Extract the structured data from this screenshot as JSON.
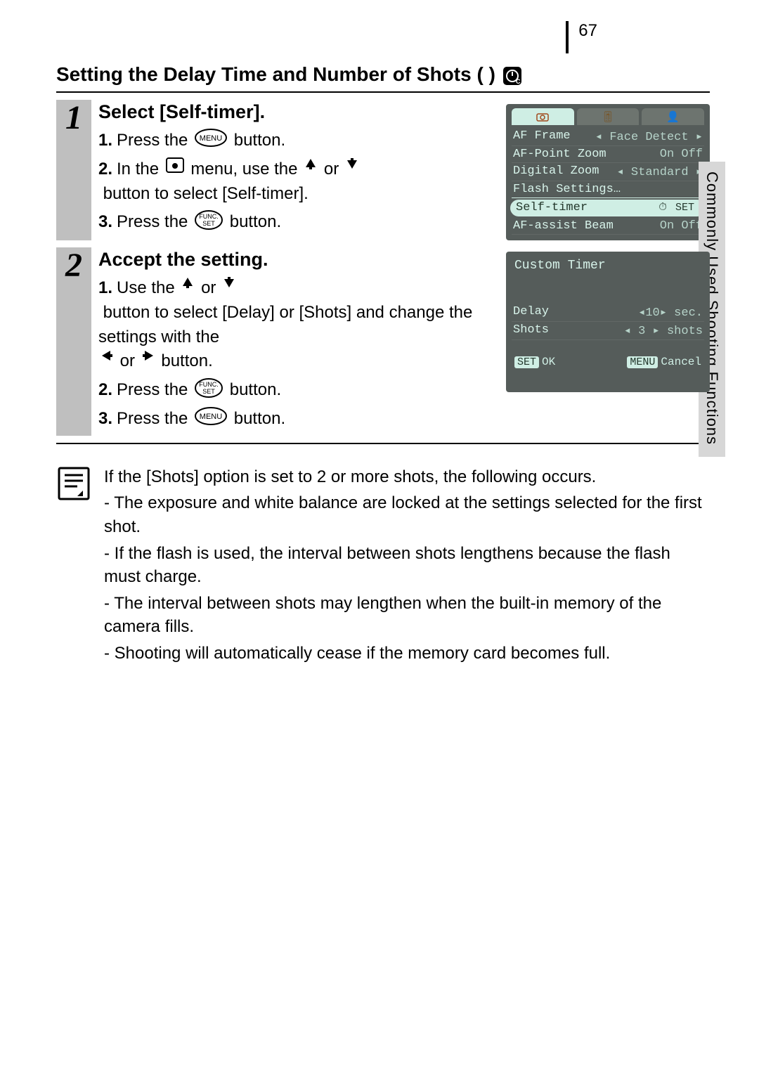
{
  "page_number": "67",
  "sidebar_label": "Commonly Used Shooting Functions",
  "title": "Setting the Delay Time and Number of Shots (    )",
  "steps": [
    {
      "num": "1",
      "heading": "Select [Self-timer].",
      "subs": [
        {
          "n": "1.",
          "pre": "Press the ",
          "icon": "menu",
          "post": " button."
        },
        {
          "n": "2.",
          "pre": "In the ",
          "icon": "camera-box",
          "mid": " menu, use the ",
          "icon2": "up",
          "mid2": " or ",
          "icon3": "down",
          "post": " button to select [Self-timer]."
        },
        {
          "n": "3.",
          "pre": "Press the ",
          "icon": "func-set",
          "post": " button."
        }
      ],
      "lcd": {
        "rows": [
          {
            "l": "AF Frame",
            "r": "◂ Face Detect ▸"
          },
          {
            "l": "AF-Point Zoom",
            "r": "On Off"
          },
          {
            "l": "Digital Zoom",
            "r": "◂ Standard ▸"
          },
          {
            "l": "Flash Settings…",
            "r": "",
            "underline": true
          },
          {
            "l": "Self-timer",
            "r": "SET",
            "selected": true
          },
          {
            "l": "AF-assist Beam",
            "r": "On Off"
          }
        ]
      }
    },
    {
      "num": "2",
      "heading": "Accept the setting.",
      "subs": [
        {
          "n": "1.",
          "pre": "Use the ",
          "icon": "up",
          "mid": " or ",
          "icon2": "down",
          "mid2": " button to select [Delay] or [Shots] and change the settings with the ",
          "icon3": "left",
          "mid3": " or ",
          "icon4": "right",
          "post": " button."
        },
        {
          "n": "2.",
          "pre": "Press the ",
          "icon": "func-set",
          "post": " button."
        },
        {
          "n": "3.",
          "pre": "Press the ",
          "icon": "menu",
          "post": " button."
        }
      ],
      "lcd2": {
        "header": "Custom Timer",
        "rows": [
          {
            "l": "Delay",
            "r": "◂10▸ sec."
          },
          {
            "l": "Shots",
            "r": "◂ 3 ▸ shots"
          }
        ],
        "foot_left": "SET OK",
        "foot_right": "MENU Cancel"
      }
    }
  ],
  "note": {
    "intro": "If the [Shots] option is set to 2 or more shots, the following occurs.",
    "bullets": [
      "- The exposure and white balance are locked at the settings selected for the first shot.",
      "- If the flash is used, the interval between shots lengthens because the flash must charge.",
      "- The interval between shots may lengthen when the built-in memory of the camera fills.",
      "- Shooting will automatically cease if the memory card becomes full."
    ]
  }
}
